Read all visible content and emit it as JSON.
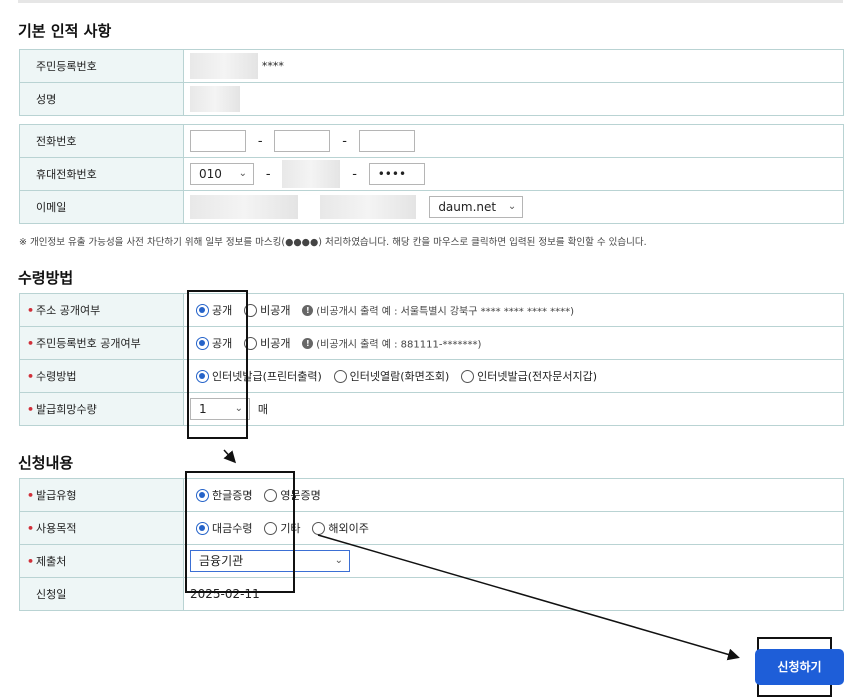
{
  "sections": {
    "basic_title": "기본 인적 사항",
    "receive_title": "수령방법",
    "apply_title": "신청내용"
  },
  "basic": {
    "rrn_label": "주민등록번호",
    "rrn_masked_suffix": "****",
    "name_label": "성명",
    "phone_label": "전화번호",
    "phone_dash": "-",
    "mobile_label": "휴대전화번호",
    "mobile_prefix": "010",
    "mobile_last": "••••",
    "email_label": "이메일",
    "email_domain": "daum.net",
    "notice": "※ 개인정보 유출 가능성을 사전 차단하기 위해 일부 정보를 마스킹(●●●●) 처리하였습니다. 해당 칸을 마우스로 클릭하면 입력된 정보를 확인할 수 있습니다."
  },
  "receive": {
    "address_label": "주소 공개여부",
    "address_public": "공개",
    "address_private": "비공개",
    "address_hint": "(비공개시 출력 예 : 서울특별시 강북구 **** **** **** ****)",
    "rrn_public_label": "주민등록번호 공개여부",
    "rrn_public": "공개",
    "rrn_private": "비공개",
    "rrn_hint": "(비공개시 출력 예 : 881111-*******)",
    "method_label": "수령방법",
    "method_options": [
      "인터넷발급(프린터출력)",
      "인터넷열람(화면조회)",
      "인터넷발급(전자문서지갑)"
    ],
    "count_label": "발급희망수량",
    "count_value": "1",
    "count_unit": "매"
  },
  "apply": {
    "type_label": "발급유형",
    "type_options": [
      "한글증명",
      "영문증명"
    ],
    "purpose_label": "사용목적",
    "purpose_options": [
      "대금수령",
      "기타",
      "해외이주"
    ],
    "submit_to_label": "제출처",
    "submit_to_value": "금융기관",
    "date_label": "신청일",
    "date_value": "2025-02-11"
  },
  "actions": {
    "submit_label": "신청하기"
  },
  "colors": {
    "header_bg": "#eef6f6",
    "border": "#b9d3d3",
    "accent": "#2563c9",
    "required": "#d0303a",
    "button": "#1e5ed8"
  }
}
